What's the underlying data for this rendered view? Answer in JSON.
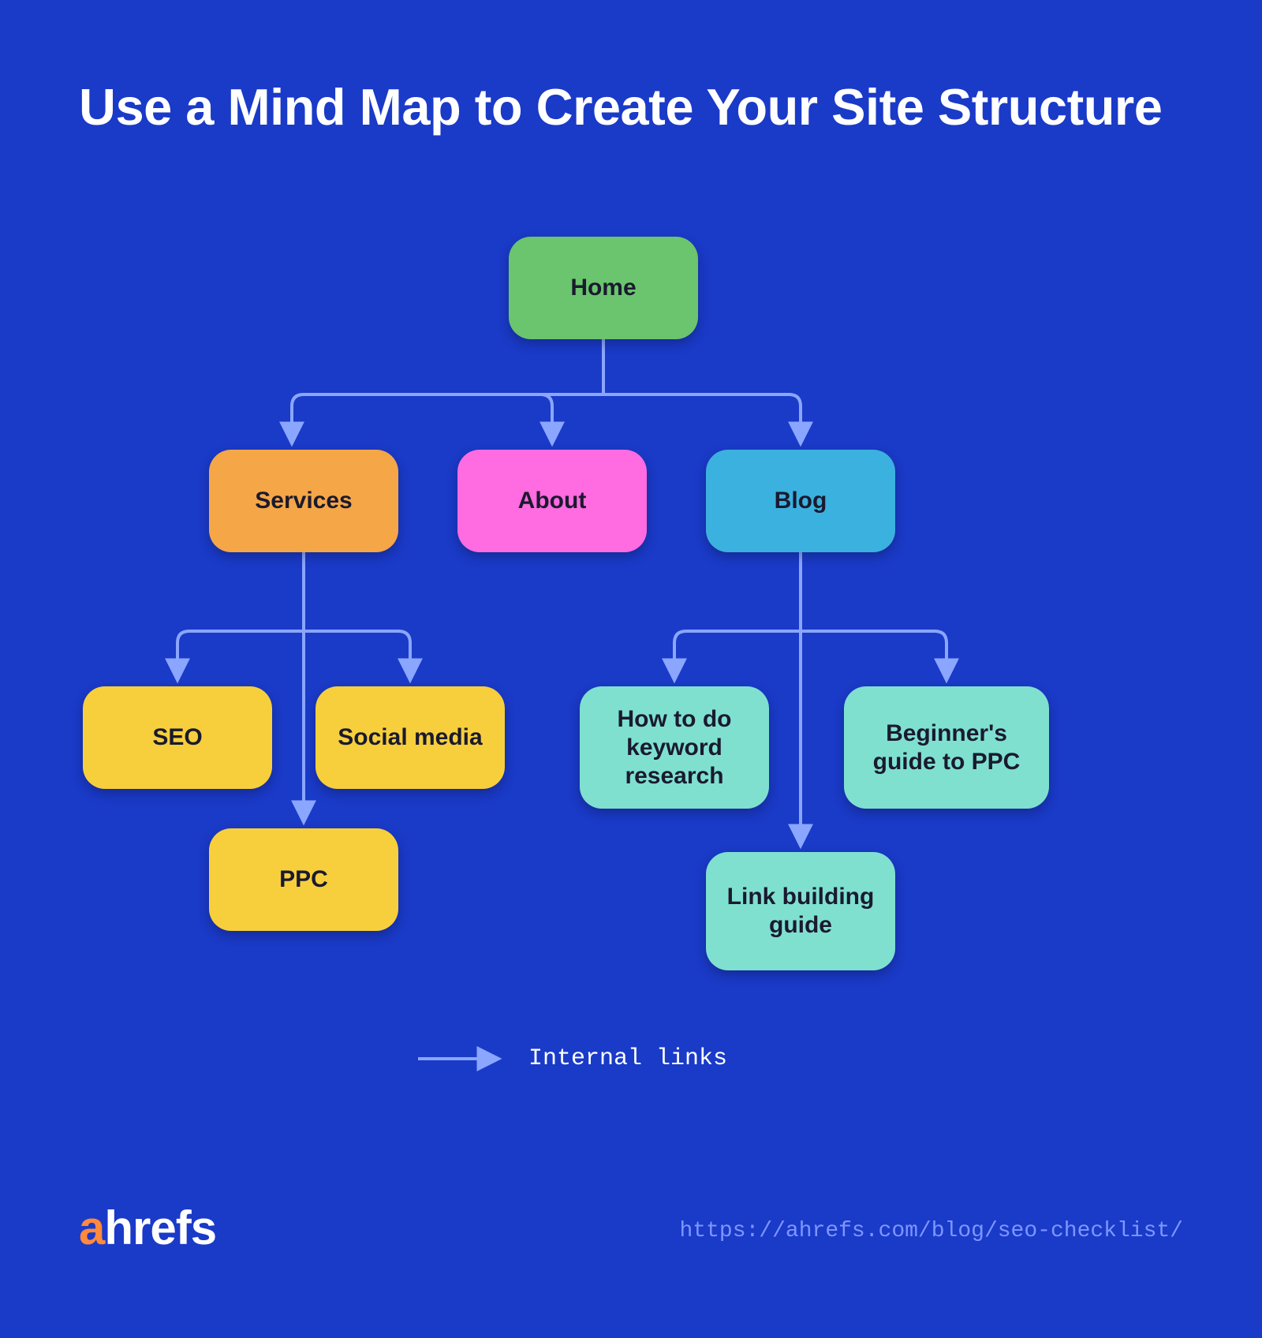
{
  "title": "Use a Mind Map to Create Your Site Structure",
  "nodes": {
    "home": "Home",
    "services": "Services",
    "about": "About",
    "blog": "Blog",
    "seo": "SEO",
    "social_media": "Social media",
    "ppc": "PPC",
    "keyword_research": "How to do keyword research",
    "beginners_ppc": "Beginner's guide to PPC",
    "link_building": "Link building guide"
  },
  "legend": "Internal links",
  "logo": {
    "highlight": "a",
    "rest": "hrefs"
  },
  "url": "https://ahrefs.com/blog/seo-checklist/",
  "colors": {
    "background": "#1a3ac8",
    "green": "#6bc46e",
    "orange": "#f5a647",
    "pink": "#ff6be0",
    "blue": "#3bb1e0",
    "yellow": "#f7cf3c",
    "teal": "#7fe0d0",
    "line": "#8aa6ff"
  }
}
